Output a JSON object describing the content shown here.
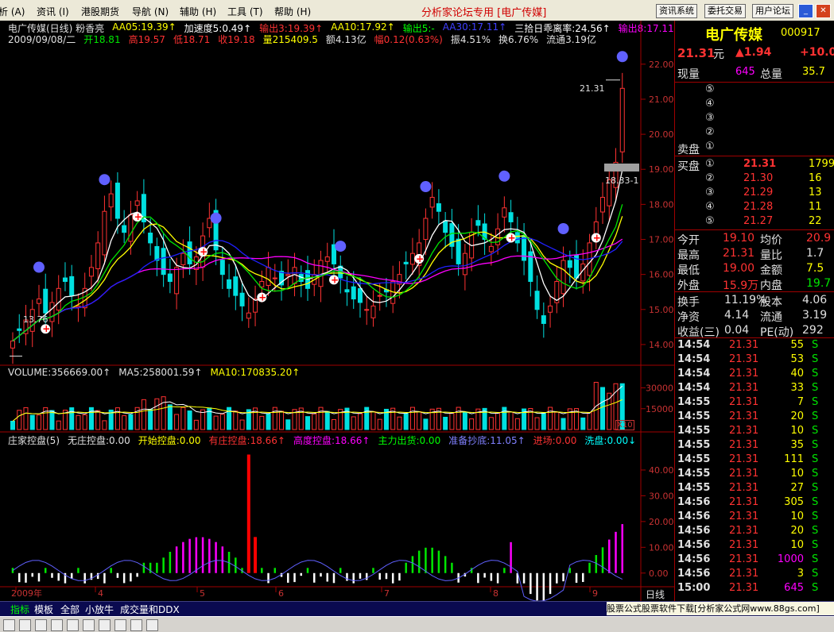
{
  "menu": {
    "items": [
      "析 (A)",
      "资讯 (I)",
      "港股期货",
      "导航 (N)",
      "辅助 (H)",
      "工具 (T)",
      "帮助 (H)"
    ],
    "title": "分析家论坛专用 [电广传媒]",
    "right_buttons": [
      "资讯系统",
      "委托交易",
      "用户论坛"
    ]
  },
  "chart": {
    "header_line1": [
      {
        "text": "电广传媒(日线) 粉香亮",
        "color": "#e0e0e0"
      },
      {
        "text": "AA05:19.39↑",
        "color": "#ffff00"
      },
      {
        "text": "加速度5:0.49↑",
        "color": "#ffffff"
      },
      {
        "text": "输出3:19.39↑",
        "color": "#ff3232"
      },
      {
        "text": "AA10:17.92↑",
        "color": "#ffff00"
      },
      {
        "text": "输出5:-",
        "color": "#00ff00"
      },
      {
        "text": "AA30:17.11↑",
        "color": "#4040ff"
      },
      {
        "text": "三拾日乖离率:24.56↑",
        "color": "#ffffff"
      },
      {
        "text": "输出8:17.11↑",
        "color": "#ff00ff"
      }
    ],
    "header_line2": [
      {
        "text": "2009/09/08/二",
        "color": "#e0e0e0"
      },
      {
        "text": "开18.81",
        "color": "#00e600"
      },
      {
        "text": "高19.57",
        "color": "#ff3232"
      },
      {
        "text": "低18.71",
        "color": "#ff3232"
      },
      {
        "text": "收19.18",
        "color": "#ff3232"
      },
      {
        "text": "量215409.5",
        "color": "#ffff00"
      },
      {
        "text": "额4.13亿",
        "color": "#e0e0e0"
      },
      {
        "text": "幅0.12(0.63%)",
        "color": "#ff3232"
      },
      {
        "text": "振4.51%",
        "color": "#e0e0e0"
      },
      {
        "text": "换6.76%",
        "color": "#e0e0e0"
      },
      {
        "text": "流通3.19亿",
        "color": "#e0e0e0"
      }
    ],
    "price_axis": [
      "22.00",
      "21.00",
      "20.00",
      "19.00",
      "18.00",
      "17.00",
      "16.00",
      "15.00",
      "14.00"
    ],
    "price_high_label": "21.31",
    "price_low_label": "13.76",
    "current_price_label": "18.33-1",
    "volume_header": [
      {
        "text": "VOLUME:356669.00↑",
        "color": "#e0e0e0"
      },
      {
        "text": "MA5:258001.59↑",
        "color": "#e0e0e0"
      },
      {
        "text": "MA10:170835.20↑",
        "color": "#ffff00"
      }
    ],
    "volume_axis": [
      "30000",
      "15000"
    ],
    "volume_unit": "X10",
    "indicator_header": [
      {
        "text": "庄家控盘(5)",
        "color": "#e0e0e0"
      },
      {
        "text": "无庄控盘:0.00",
        "color": "#e0e0e0"
      },
      {
        "text": "开始控盘:0.00",
        "color": "#ffff00"
      },
      {
        "text": "有庄控盘:18.66↑",
        "color": "#ff3232"
      },
      {
        "text": "高度控盘:18.66↑",
        "color": "#ff00ff"
      },
      {
        "text": "主力出货:0.00",
        "color": "#00ff00"
      },
      {
        "text": "准备抄底:11.05↑",
        "color": "#8080ff"
      },
      {
        "text": "进场:0.00",
        "color": "#ff3232"
      },
      {
        "text": "洗盘:0.00↓",
        "color": "#00ffff"
      }
    ],
    "indicator_axis": [
      "40.00",
      "30.00",
      "20.00",
      "10.00",
      "0.00"
    ],
    "date_axis": [
      "2009年",
      "4",
      "5",
      "6",
      "7",
      "8",
      "9"
    ],
    "period": "日线"
  },
  "quote": {
    "name": "电广传媒",
    "code": "000917",
    "price": "21.31",
    "price_unit": "元",
    "change": "▲1.94",
    "change_pct": "+10.0",
    "now_vol_label": "现量",
    "now_vol": "645",
    "total_vol_label": "总量",
    "total_vol": "35.7",
    "sell_label": "卖盘",
    "buy_label": "买盘",
    "sell_levels": [
      "⑤",
      "④",
      "③",
      "②",
      "①"
    ],
    "buy_levels": [
      {
        "lvl": "①",
        "price": "21.31",
        "vol": "1799"
      },
      {
        "lvl": "②",
        "price": "21.30",
        "vol": "16"
      },
      {
        "lvl": "③",
        "price": "21.29",
        "vol": "13"
      },
      {
        "lvl": "④",
        "price": "21.28",
        "vol": "11"
      },
      {
        "lvl": "⑤",
        "price": "21.27",
        "vol": "22"
      }
    ],
    "stats": [
      {
        "l1": "今开",
        "v1": "19.10",
        "c1": "#ff3232",
        "l2": "均价",
        "v2": "20.9",
        "c2": "#ff3232"
      },
      {
        "l1": "最高",
        "v1": "21.31",
        "c1": "#ff3232",
        "l2": "量比",
        "v2": "1.7",
        "c2": "#e0e0e0"
      },
      {
        "l1": "最低",
        "v1": "19.00",
        "c1": "#ff3232",
        "l2": "金额",
        "v2": "7.5",
        "c2": "#ffff00"
      },
      {
        "l1": "外盘",
        "v1": "15.9万",
        "c1": "#ff3232",
        "l2": "内盘",
        "v2": "19.7",
        "c2": "#00e600"
      }
    ],
    "stats2": [
      {
        "l1": "换手",
        "v1": "11.19%",
        "l2": "股本",
        "v2": "4.06"
      },
      {
        "l1": "净资",
        "v1": "4.14",
        "l2": "流通",
        "v2": "3.19"
      },
      {
        "l1": "收益(三)",
        "v1": "0.04",
        "l2": "PE(动)",
        "v2": "292"
      }
    ],
    "ticks": [
      {
        "t": "14:54",
        "p": "21.31",
        "v": "55",
        "s": "S"
      },
      {
        "t": "14:54",
        "p": "21.31",
        "v": "53",
        "s": "S"
      },
      {
        "t": "14:54",
        "p": "21.31",
        "v": "40",
        "s": "S"
      },
      {
        "t": "14:54",
        "p": "21.31",
        "v": "33",
        "s": "S"
      },
      {
        "t": "14:55",
        "p": "21.31",
        "v": "7",
        "s": "S"
      },
      {
        "t": "14:55",
        "p": "21.31",
        "v": "20",
        "s": "S"
      },
      {
        "t": "14:55",
        "p": "21.31",
        "v": "10",
        "s": "S"
      },
      {
        "t": "14:55",
        "p": "21.31",
        "v": "35",
        "s": "S"
      },
      {
        "t": "14:55",
        "p": "21.31",
        "v": "111",
        "s": "S"
      },
      {
        "t": "14:55",
        "p": "21.31",
        "v": "10",
        "s": "S"
      },
      {
        "t": "14:55",
        "p": "21.31",
        "v": "27",
        "s": "S"
      },
      {
        "t": "14:56",
        "p": "21.31",
        "v": "305",
        "s": "S"
      },
      {
        "t": "14:56",
        "p": "21.31",
        "v": "10",
        "s": "S"
      },
      {
        "t": "14:56",
        "p": "21.31",
        "v": "20",
        "s": "S"
      },
      {
        "t": "14:56",
        "p": "21.31",
        "v": "10",
        "s": "S"
      },
      {
        "t": "14:56",
        "p": "21.31",
        "v": "1000",
        "s": "S"
      },
      {
        "t": "14:56",
        "p": "21.31",
        "v": "3",
        "s": "S"
      },
      {
        "t": "15:00",
        "p": "21.31",
        "v": "645",
        "s": "S"
      }
    ]
  },
  "tabs": {
    "items": [
      "指标",
      "模板",
      "全部",
      "小放牛",
      "成交量和DDX"
    ],
    "ad": "股票公式股票软件下载[分析家公式网www.88gs.com]"
  },
  "chart_data": {
    "type": "candlestick",
    "ohlc_close_path": [
      14.1,
      14.4,
      14.7,
      15.0,
      15.3,
      14.9,
      15.2,
      15.6,
      15.8,
      15.4,
      15.1,
      15.6,
      16.2,
      16.9,
      17.8,
      18.3,
      17.6,
      17.2,
      17.7,
      18.1,
      17.5,
      16.9,
      16.4,
      16.0,
      15.8,
      16.2,
      16.6,
      16.3,
      16.5,
      17.1,
      17.6,
      16.7,
      16.0,
      15.6,
      15.4,
      15.1,
      14.9,
      15.3,
      15.8,
      16.2,
      15.9,
      15.7,
      16.0,
      16.2,
      15.8,
      15.6,
      16.0,
      16.4,
      16.5,
      16.3,
      15.9,
      15.5,
      15.3,
      15.2,
      15.0,
      15.1,
      15.4,
      15.5,
      15.8,
      16.0,
      16.3,
      16.6,
      16.9,
      17.6,
      18.2,
      17.8,
      17.2,
      16.8,
      16.3,
      16.6,
      17.2,
      17.4,
      17.0,
      16.8,
      17.3,
      17.9,
      17.5,
      16.9,
      16.4,
      15.8,
      15.0,
      14.6,
      15.1,
      15.8,
      16.4,
      16.2,
      15.9,
      16.3,
      16.9,
      17.5,
      18.2,
      18.7,
      19.2,
      21.31
    ],
    "price_range": [
      13.5,
      22.2
    ],
    "price_high": 21.31,
    "price_low": 13.76,
    "volume_range": [
      0,
      36000
    ],
    "indicator_range": [
      -5,
      48
    ]
  }
}
